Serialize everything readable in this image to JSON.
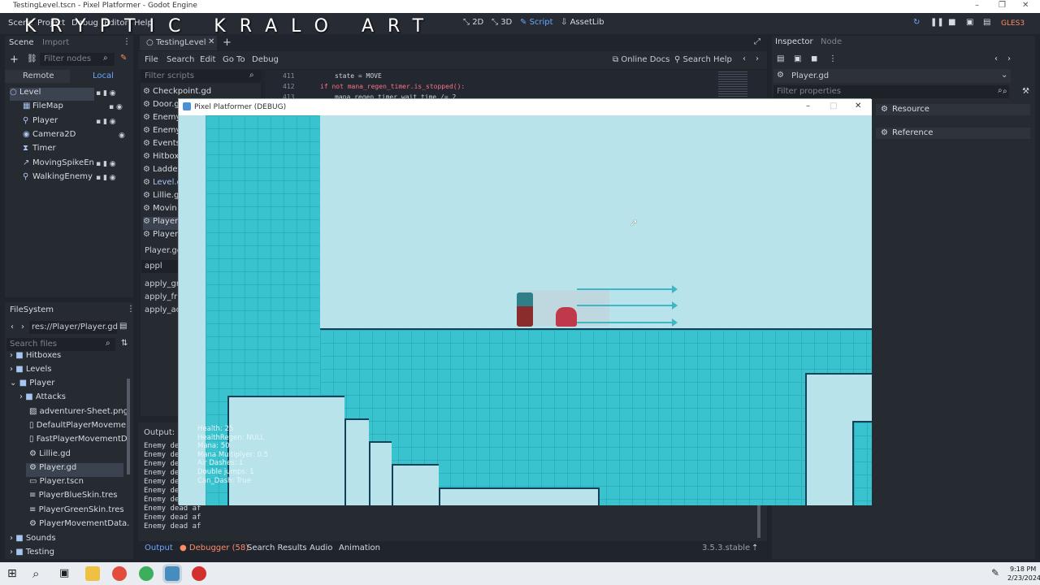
{
  "window": {
    "title": "TestingLevel.tscn - Pixel Platformer - Godot Engine"
  },
  "watermark": "KRYPTIC KRALO ART",
  "menu": [
    "Scene",
    "Project",
    "Debug",
    "Editor",
    "Help"
  ],
  "workspaces": [
    {
      "label": "2D",
      "icon": "2d-icon"
    },
    {
      "label": "3D",
      "icon": "3d-icon"
    },
    {
      "label": "Script",
      "icon": "script-icon"
    },
    {
      "label": "AssetLib",
      "icon": "assetlib-icon"
    }
  ],
  "renderer": "GLES3",
  "scene_dock": {
    "tabs": [
      "Scene",
      "Import"
    ],
    "filter_placeholder": "Filter nodes",
    "remote": "Remote",
    "local": "Local",
    "nodes": [
      "Level",
      "FileMap",
      "Player",
      "Camera2D",
      "Timer",
      "MovingSpikeEn",
      "WalkingEnemy"
    ]
  },
  "filesystem": {
    "title": "FileSystem",
    "path": "res://Player/Player.gd",
    "search_placeholder": "Search files",
    "items": [
      "Hitboxes",
      "Levels",
      "Player",
      "Attacks",
      "adventurer-Sheet.png",
      "DefaultPlayerMoveme",
      "FastPlayerMovementD",
      "Lillie.gd",
      "Player.gd",
      "Player.tscn",
      "PlayerBlueSkin.tres",
      "PlayerGreenSkin.tres",
      "PlayerMovementData.",
      "Sounds",
      "Testing"
    ]
  },
  "editor": {
    "tab": "TestingLevel",
    "menu": [
      "File",
      "Search",
      "Edit",
      "Go To",
      "Debug"
    ],
    "online_docs": "Online Docs",
    "search_help": "Search Help",
    "filter_scripts": "Filter scripts",
    "scripts": [
      "Checkpoint.gd",
      "Door.gd",
      "Enemy",
      "Enemy",
      "Events",
      "Hitbox",
      "Ladde",
      "Level.g",
      "Lillie.g",
      "Movin",
      "Player",
      "Player"
    ],
    "current_script": "Player.gd",
    "method_filter": "appl",
    "methods": [
      "apply_gra",
      "apply_fric",
      "apply_acc"
    ],
    "code": [
      {
        "num": "411",
        "text": "state = MOVE"
      },
      {
        "num": "412",
        "text": "if not mana_regen_timer.is_stopped():"
      },
      {
        "num": "413",
        "text": "mana_regen_timer.wait_time /= 2"
      }
    ]
  },
  "output": {
    "label": "Output:",
    "lines": [
      "Enemy de",
      "Enemy de",
      "Enemy de",
      "Enemy de",
      "Enemy de",
      "Enemy de",
      "Enemy de",
      "Enemy dead af",
      "Enemy dead af",
      "Enemy dead af"
    ],
    "tabs": [
      "Output",
      "Debugger (58)",
      "Search Results",
      "Audio",
      "Animation"
    ],
    "version": "3.5.3.stable"
  },
  "inspector": {
    "tabs": [
      "Inspector",
      "Node"
    ],
    "resource_name": "Player.gd",
    "filter_placeholder": "Filter properties",
    "sections": [
      "Resource",
      "Reference"
    ]
  },
  "game": {
    "title": "Pixel Platformer (DEBUG)",
    "hud": [
      "Health: 25",
      "HealthRegen: NULL",
      "Mana: 50",
      "Mana Multiplyer: 0.5",
      "Air Dashes: 1",
      "Double jumps: 1",
      "Can_Dash: True"
    ]
  },
  "taskbar": {
    "time": "9:18 PM",
    "date": "2/23/2024"
  },
  "colors": {
    "tile": "#38c3cf",
    "sky": "#b8e3ea",
    "accent": "#6aa7ff",
    "debugger": "#ff8a65"
  }
}
